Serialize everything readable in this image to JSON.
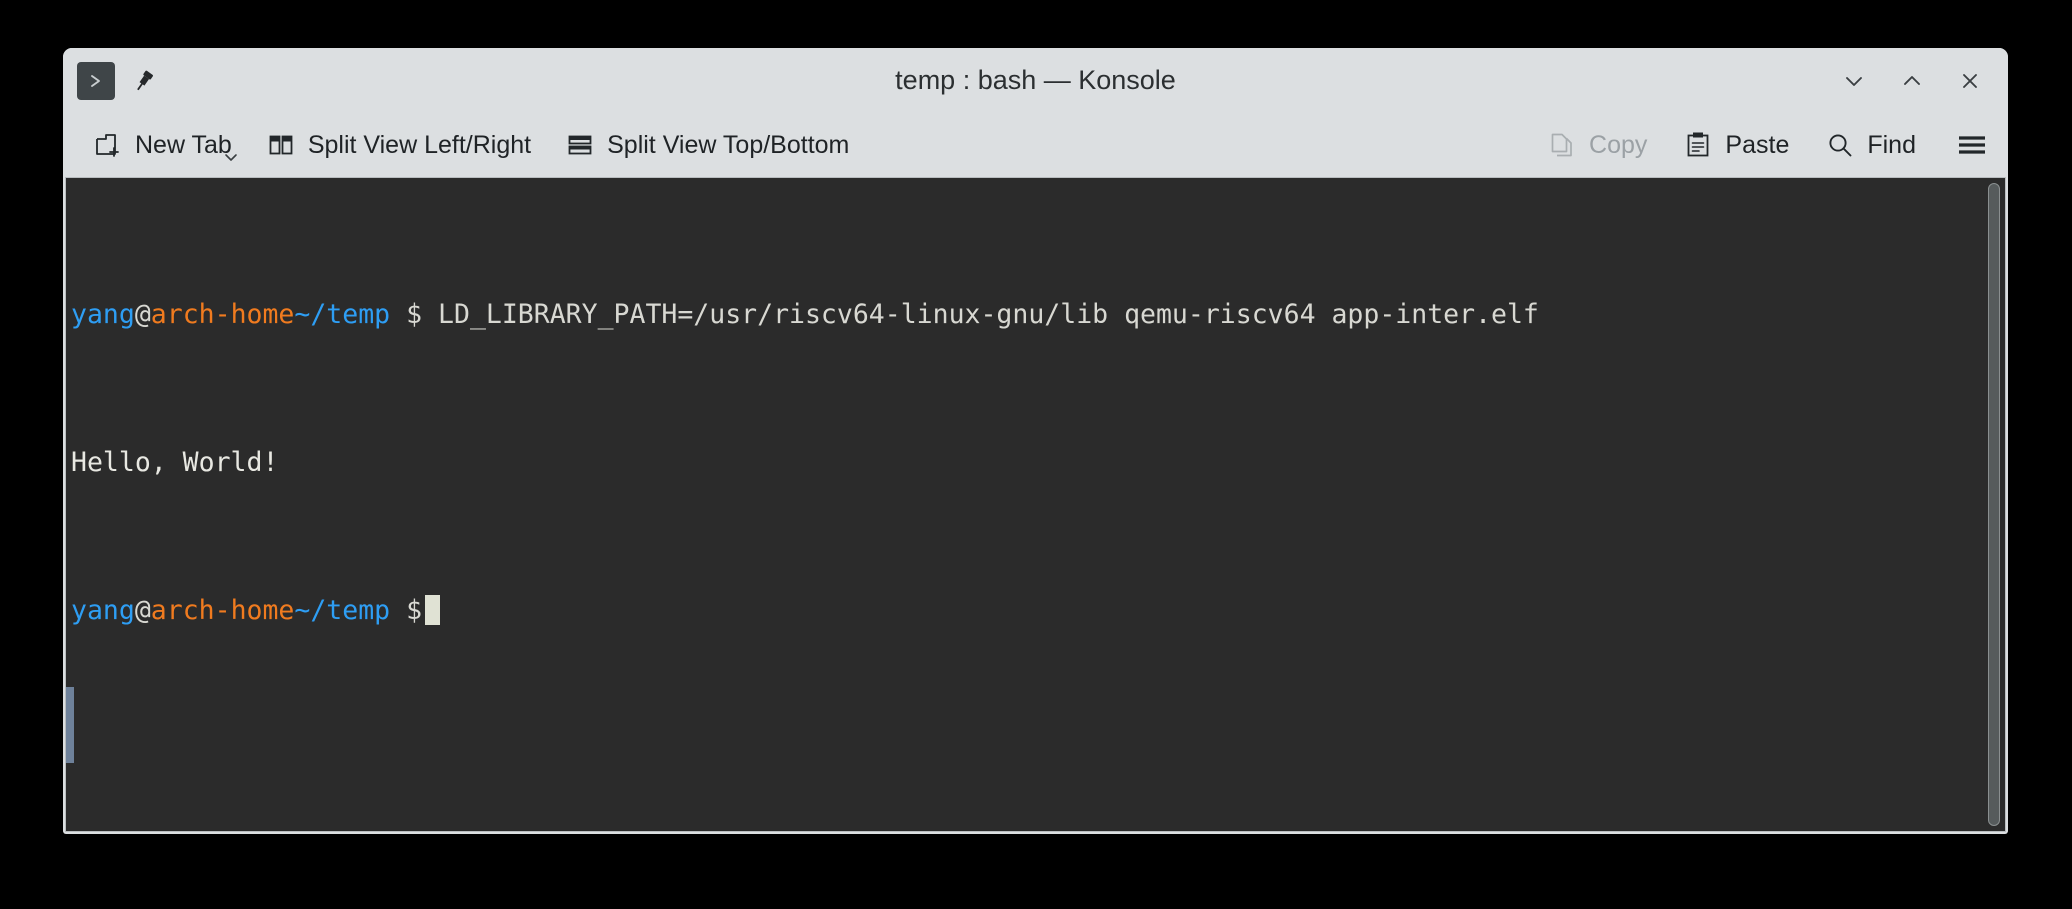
{
  "window": {
    "title": "temp : bash — Konsole",
    "app_icon": "konsole-prompt-icon",
    "pin_icon": "pin-icon",
    "controls": {
      "minimize": "minimize-icon",
      "maximize": "maximize-icon",
      "close": "close-icon"
    },
    "colors": {
      "chrome_bg": "#dcdfe1",
      "terminal_bg": "#2b2b2b",
      "text": "#d8d8d2",
      "user": "#2e9ef4",
      "host": "#f07b1f",
      "path": "#2e9ef4",
      "cursor": "#e0e2d4",
      "marker": "#6e819a"
    }
  },
  "toolbar": {
    "new_tab": {
      "label": "New Tab",
      "icon": "new-tab-icon",
      "has_menu": true
    },
    "split_left_right": {
      "label": "Split View Left/Right",
      "icon": "split-vertical-icon"
    },
    "split_top_bottom": {
      "label": "Split View Top/Bottom",
      "icon": "split-horizontal-icon"
    },
    "copy": {
      "label": "Copy",
      "icon": "copy-icon",
      "enabled": false
    },
    "paste": {
      "label": "Paste",
      "icon": "paste-icon",
      "enabled": true
    },
    "find": {
      "label": "Find",
      "icon": "search-icon",
      "enabled": true
    },
    "menu": {
      "icon": "hamburger-menu-icon"
    }
  },
  "terminal": {
    "prompt": {
      "user": "yang",
      "at": "@",
      "host": "arch-home",
      "path": "~/temp",
      "symbol": "$"
    },
    "line1_command": "LD_LIBRARY_PATH=/usr/riscv64-linux-gnu/lib qemu-riscv64 app-inter.elf",
    "line2_output": "Hello, World!",
    "cursor": "block"
  }
}
